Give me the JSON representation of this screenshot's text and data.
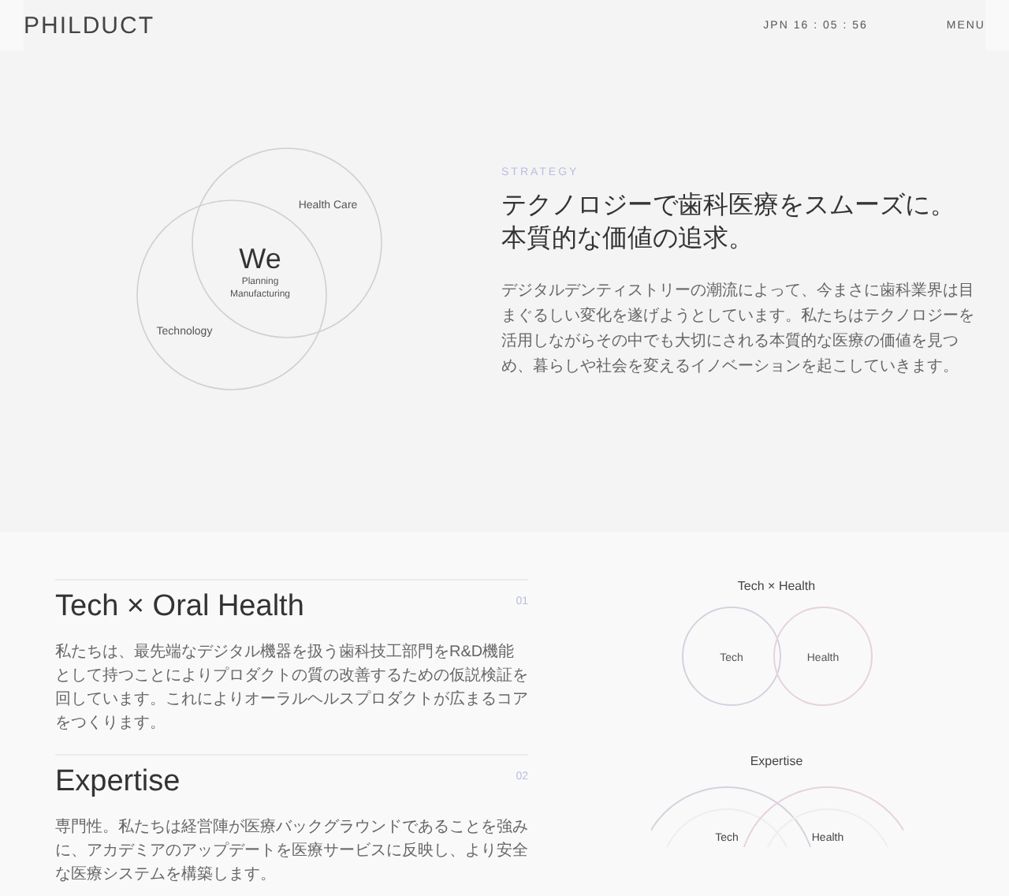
{
  "header": {
    "logo": "PHILDUCT",
    "clock": "JPN 16 : 05 : 56",
    "menu": "MENU"
  },
  "strategy": {
    "diagram": {
      "center": "We",
      "center_sub": [
        "Planning",
        "Manufacturing"
      ],
      "labels": [
        "Health Care",
        "Technology"
      ]
    },
    "eyebrow": "STRATEGY",
    "heading_lines": [
      "テクノロジーで歯科医療をスムーズに。",
      "本質的な価値の追求。"
    ],
    "body": "デジタルデンティストリーの潮流によって、今まさに歯科業界は目まぐるしい変化を遂げようとしています。私たちはテクノロジーを活用しながらその中でも大切にされる本質的な医療の価値を見つめ、暮らしや社会を変えるイノベーションを起こしていきます。"
  },
  "features": [
    {
      "number": "01",
      "title": "Tech × Oral Health",
      "body": "私たちは、最先端なデジタル機器を扱う歯科技工部門をR&D機能として持つことによりプロダクトの質の改善するための仮説検証を回しています。これによりオーラルヘルスプロダクトが広まるコアをつくります。",
      "diagram": {
        "kind": "simple",
        "title": "Tech × Health",
        "circles": [
          "Tech",
          "Health"
        ]
      }
    },
    {
      "number": "02",
      "title": "Expertise",
      "body": "専門性。私たちは経営陣が医療バックグラウンドであることを強みに、アカデミアのアップデートを医療サービスに反映し、より安全な医療システムを構築します。",
      "diagram": {
        "kind": "ringed",
        "title": "Expertise",
        "circles": [
          "Tech",
          "Health"
        ]
      }
    }
  ]
}
